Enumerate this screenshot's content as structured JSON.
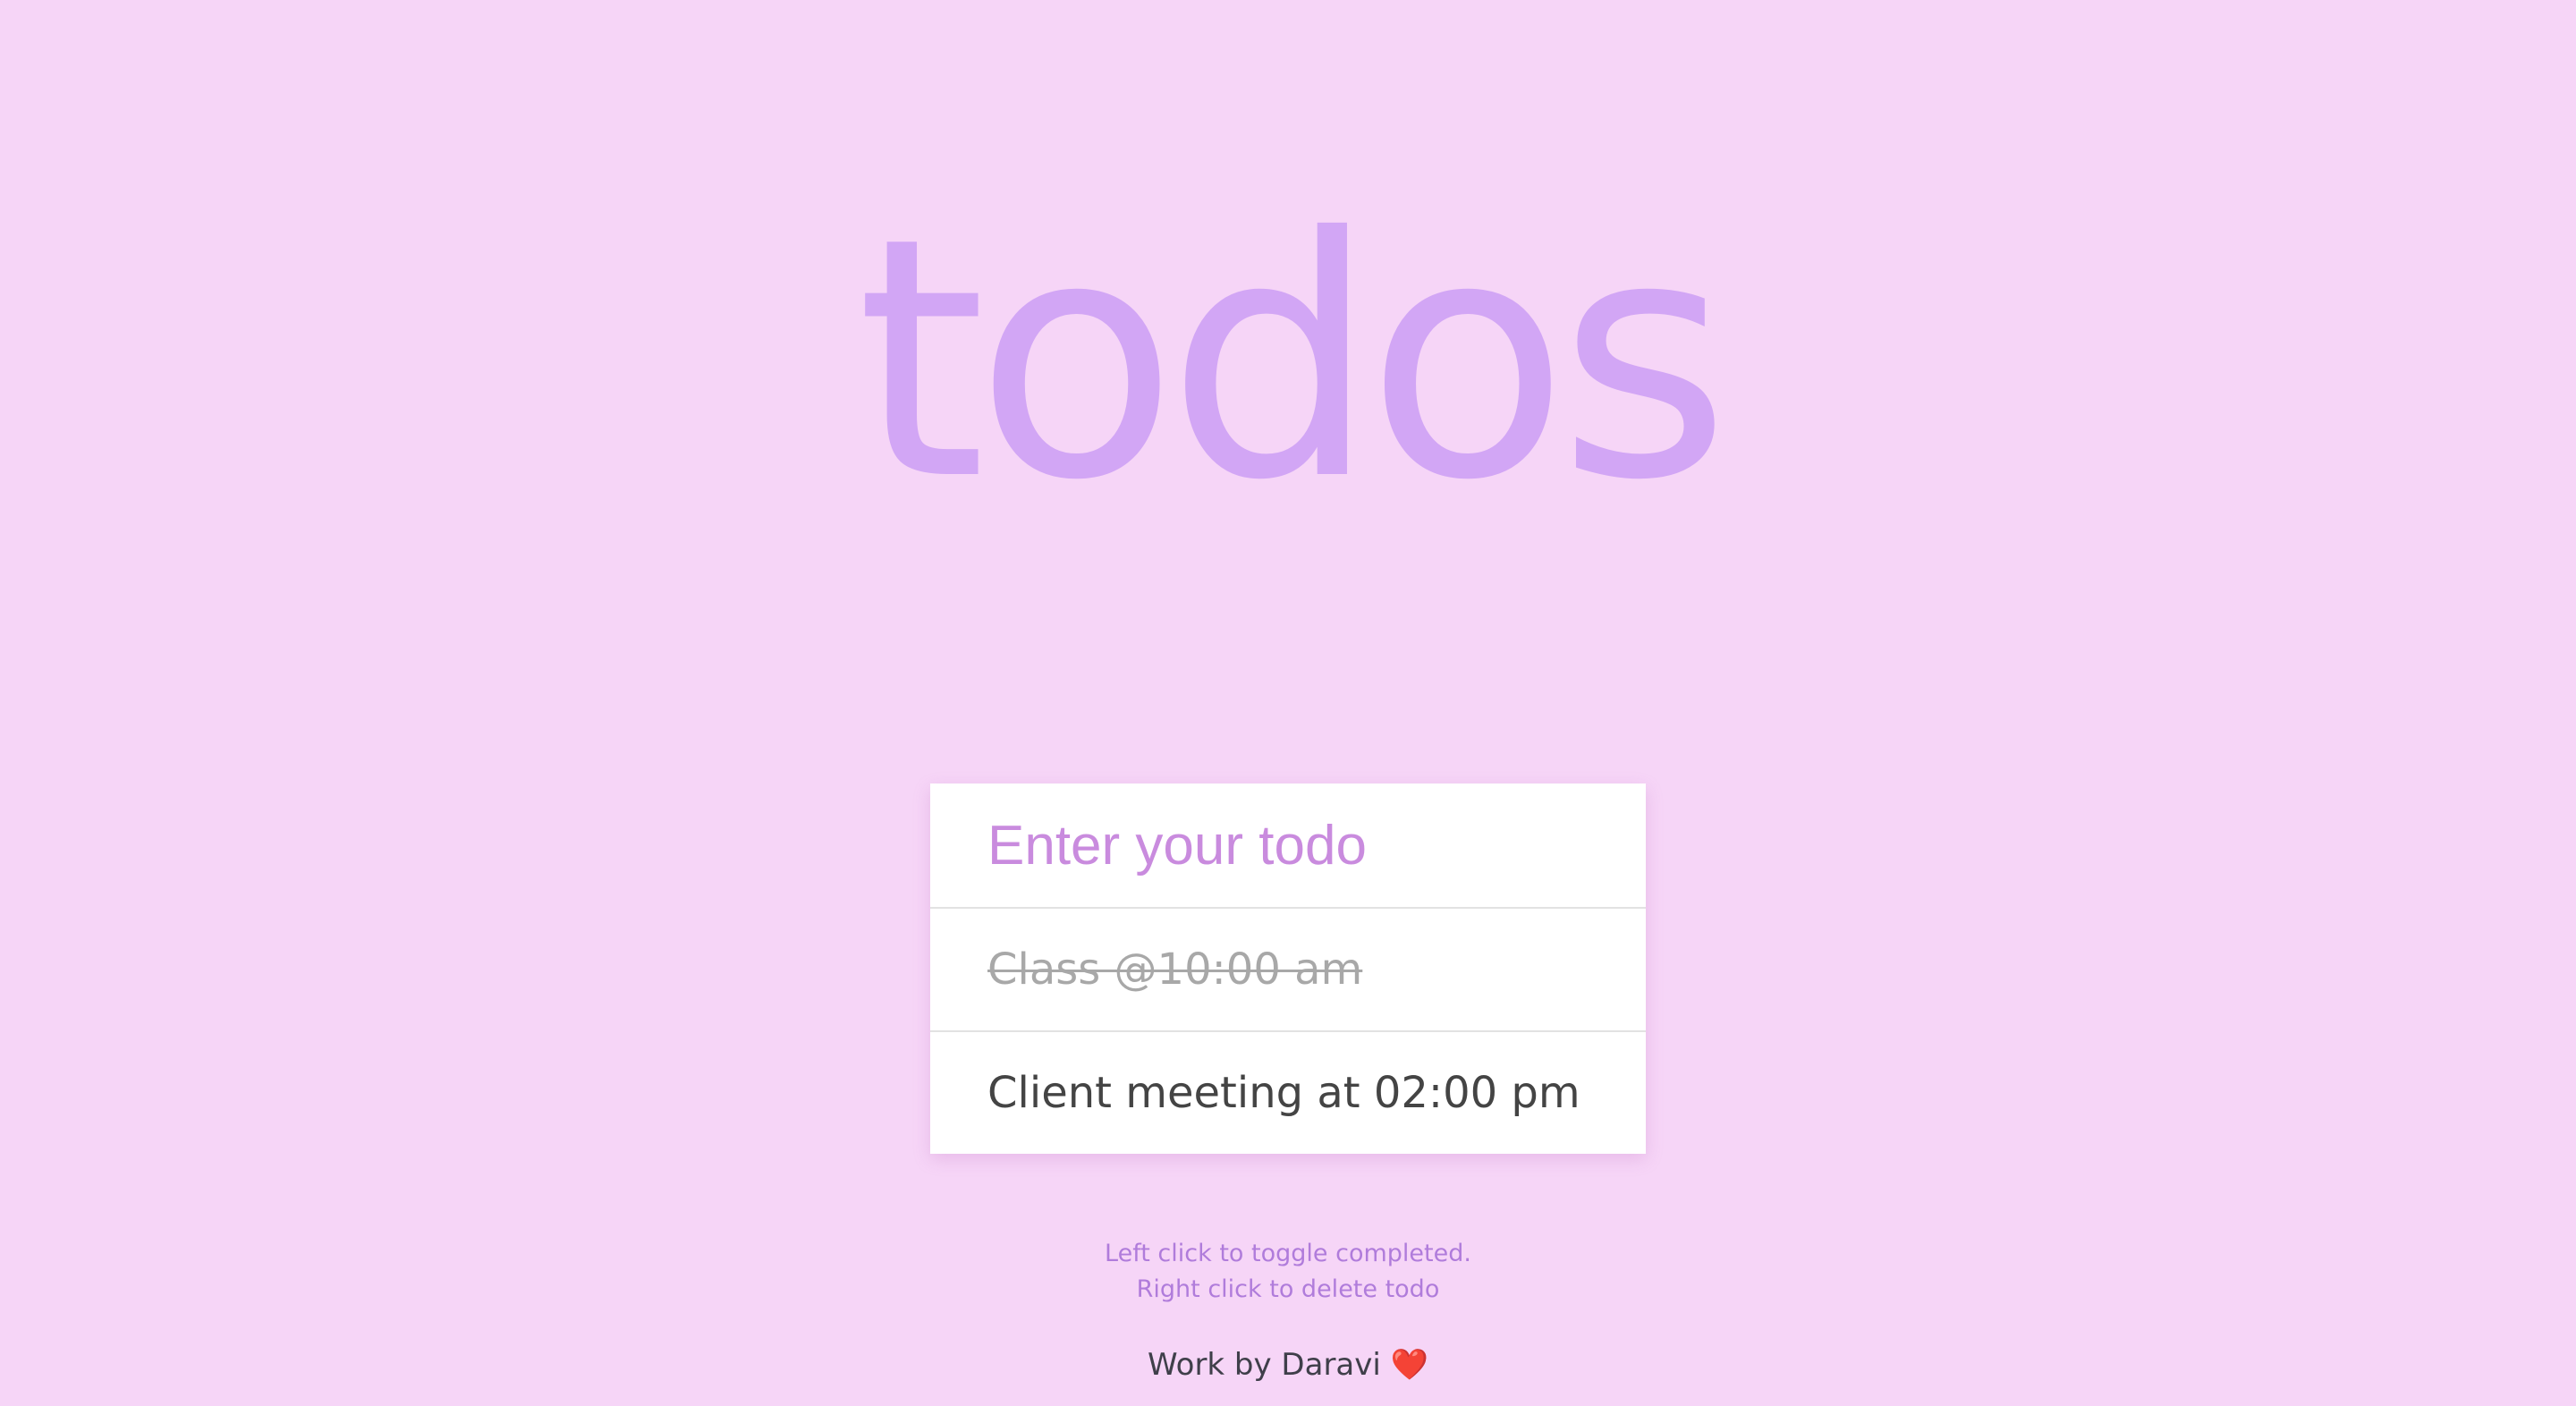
{
  "header": {
    "title": "todos"
  },
  "form": {
    "placeholder": "Enter your todo",
    "value": ""
  },
  "todos": [
    {
      "text": "Class @10:00 am",
      "completed": true
    },
    {
      "text": "Client meeting at 02:00 pm",
      "completed": false
    }
  ],
  "hints": {
    "line1": "Left click to toggle completed.",
    "line2": "Right click to delete todo"
  },
  "footer": {
    "text": "Work by Daravi",
    "icon": "❤️",
    "icon_name": "heart-icon"
  },
  "colors": {
    "background": "#f6d5f7",
    "title": "#d2a6f5",
    "placeholder": "#c98bde",
    "hint": "#b07cdb",
    "completed": "#a8a8a8",
    "text": "#444444"
  }
}
